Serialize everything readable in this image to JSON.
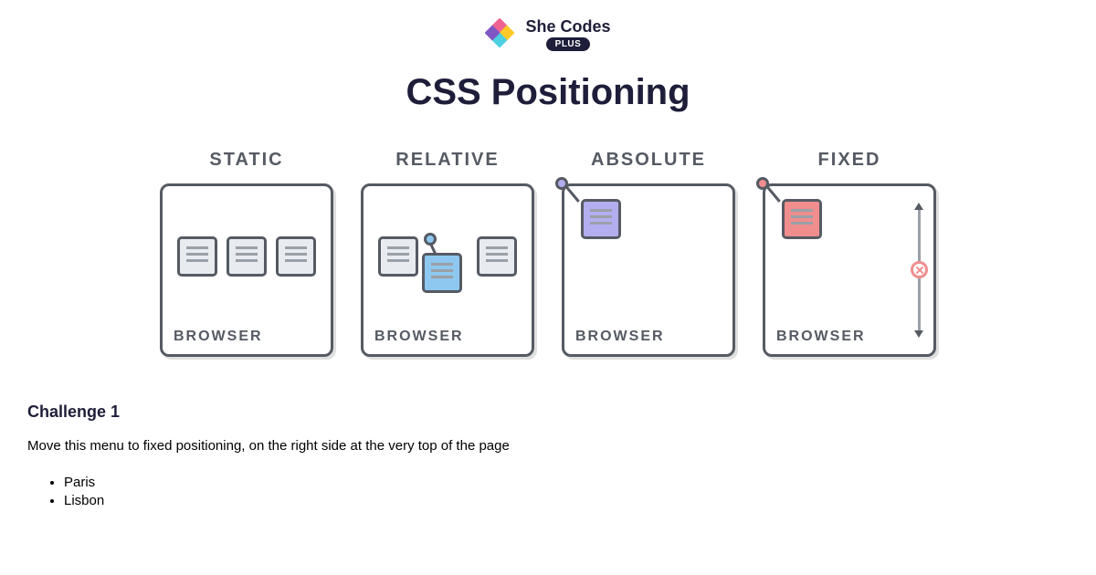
{
  "brand": {
    "name": "She Codes",
    "badge": "PLUS",
    "logo_colors": [
      "#f06292",
      "#ffca28",
      "#4dd0e1",
      "#7e57c2"
    ]
  },
  "page_title": "CSS Positioning",
  "diagram": {
    "browser_label": "BROWSER",
    "columns": [
      {
        "title": "STATIC"
      },
      {
        "title": "RELATIVE"
      },
      {
        "title": "ABSOLUTE"
      },
      {
        "title": "FIXED"
      }
    ],
    "pin_colors": {
      "relative": "#8ec8f0",
      "absolute": "#b3aef0",
      "fixed": "#f08d8d"
    }
  },
  "challenge": {
    "heading": "Challenge 1",
    "instructions": "Move this menu to fixed positioning, on the right side at the very top of the page",
    "menu_items": [
      "Paris",
      "Lisbon"
    ]
  }
}
